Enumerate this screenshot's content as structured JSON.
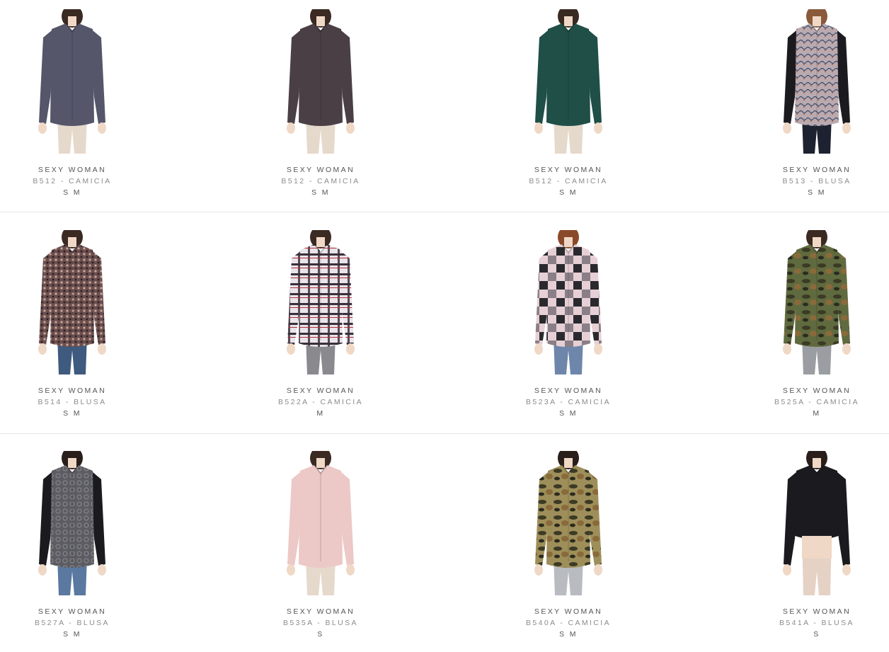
{
  "products": [
    {
      "brand": "SEXY WOMAN",
      "name": "B512 - CAMICIA",
      "sizes": "S M",
      "garment": "#55566a",
      "pattern": "plain",
      "legs": "#e5d9cc",
      "skin": "#f0d8c6",
      "hair": "#3a2a22"
    },
    {
      "brand": "SEXY WOMAN",
      "name": "B512 - CAMICIA",
      "sizes": "S M",
      "garment": "#4a3f45",
      "pattern": "plain",
      "legs": "#e5d9cc",
      "skin": "#f0d8c6",
      "hair": "#3a2a22"
    },
    {
      "brand": "SEXY WOMAN",
      "name": "B512 - CAMICIA",
      "sizes": "S M",
      "garment": "#1f4f47",
      "pattern": "plain",
      "legs": "#e5d9cc",
      "skin": "#f0d8c6",
      "hair": "#3a2a22"
    },
    {
      "brand": "SEXY WOMAN",
      "name": "B513 - BLUSA",
      "sizes": "S M",
      "garment": "#b9aab0",
      "pattern": "scarf",
      "legs": "#1e2230",
      "skin": "#f0d8c6",
      "hair": "#8a5a3a"
    },
    {
      "brand": "SEXY WOMAN",
      "name": "B514 - BLUSA",
      "sizes": "S M",
      "garment": "#6b4f4f",
      "pattern": "print",
      "legs": "#3e5a7e",
      "skin": "#f0d8c6",
      "hair": "#3a2a22"
    },
    {
      "brand": "SEXY WOMAN",
      "name": "B522A - CAMICIA",
      "sizes": "M",
      "garment": "#e9e4ea",
      "pattern": "plaid",
      "legs": "#8a8a8e",
      "skin": "#f0d8c6",
      "hair": "#3a2a22"
    },
    {
      "brand": "SEXY WOMAN",
      "name": "B523A - CAMICIA",
      "sizes": "S M",
      "garment": "#e7cfd6",
      "pattern": "check",
      "legs": "#6e86aa",
      "skin": "#f0d8c6",
      "hair": "#8a4a2a"
    },
    {
      "brand": "SEXY WOMAN",
      "name": "B525A - CAMICIA",
      "sizes": "M",
      "garment": "#5f6a3f",
      "pattern": "camo",
      "legs": "#9a9ea2",
      "skin": "#f0d8c6",
      "hair": "#3a2a22"
    },
    {
      "brand": "SEXY WOMAN",
      "name": "B527A - BLUSA",
      "sizes": "S M",
      "garment": "#1b1b1f",
      "pattern": "lace",
      "legs": "#5a78a0",
      "skin": "#f0d8c6",
      "hair": "#2a1e1a"
    },
    {
      "brand": "SEXY WOMAN",
      "name": "B535A - BLUSA",
      "sizes": "S",
      "garment": "#ecc8c6",
      "pattern": "plain",
      "legs": "#e5d9cc",
      "skin": "#f0d8c6",
      "hair": "#3a2a22"
    },
    {
      "brand": "SEXY WOMAN",
      "name": "B540A - CAMICIA",
      "sizes": "S M",
      "garment": "#9e8f5a",
      "pattern": "camo",
      "legs": "#b8bcc0",
      "skin": "#f0d8c6",
      "hair": "#2a1e1a"
    },
    {
      "brand": "SEXY WOMAN",
      "name": "B541A - BLUSA",
      "sizes": "S",
      "garment": "#1b1b1f",
      "pattern": "crop",
      "legs": "#e5d2c4",
      "skin": "#f0d8c6",
      "hair": "#2a1e1a"
    }
  ]
}
